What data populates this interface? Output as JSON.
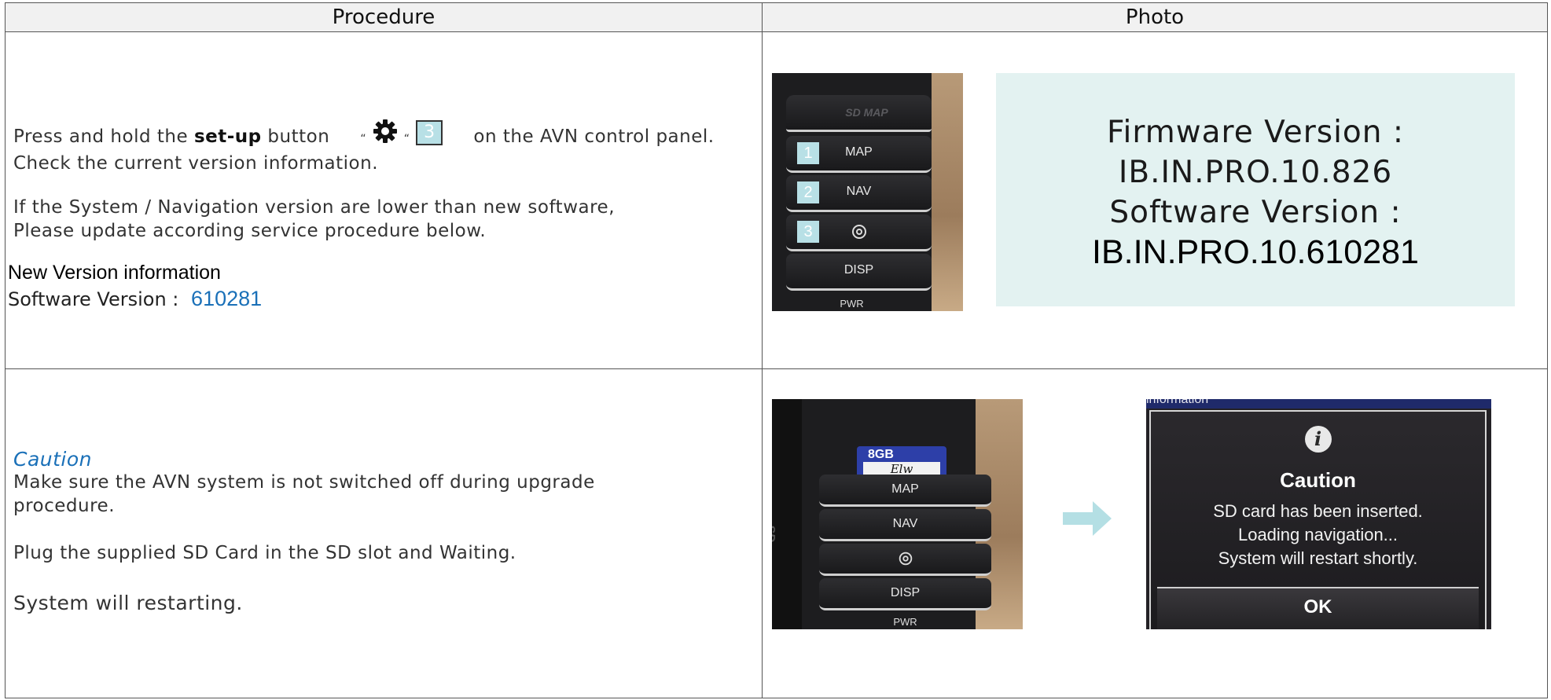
{
  "table": {
    "headers": [
      "Procedure",
      "Photo"
    ]
  },
  "step1": {
    "line1_a": "Press and hold the",
    "line1_bold": "set-up",
    "line1_b": "button",
    "quote_open": "“",
    "quote_close": "“",
    "tag_number": "3",
    "line1_c": "on the AVN control panel.",
    "line2": "Check the current version information.",
    "line3": "If the System / Navigation version are lower than new software,",
    "line4": "Please update according service procedure below.",
    "new_version_title": "New Version information",
    "software_label": "Software Version :",
    "software_value": "610281"
  },
  "panel_photo": {
    "sd_label": "SD MAP",
    "buttons": [
      {
        "tag": "1",
        "label": "MAP"
      },
      {
        "tag": "2",
        "label": "NAV"
      },
      {
        "tag": "3",
        "label": "",
        "icon": "gear-icon"
      }
    ],
    "disp_label": "DISP",
    "pwr_label": "PWR"
  },
  "version_box": {
    "firmware_label": "Firmware Version :",
    "firmware_value": "IB.IN.PRO.10.826",
    "software_label": "Software Version :",
    "software_value": "IB.IN.PRO.10.610281"
  },
  "step2": {
    "caution": "Caution",
    "line1": "Make sure the AVN system is not switched off during upgrade",
    "line2": "procedure.",
    "line3": "Plug the supplied SD Card in the SD slot and Waiting.",
    "line4": "System will restarting."
  },
  "sd_photo": {
    "card_size": "8GB",
    "card_note": "Elw",
    "buttons": [
      "MAP",
      "NAV",
      "",
      "DISP"
    ],
    "pwr_label": "PWR"
  },
  "caution_screen": {
    "top_text": "information",
    "title": "Caution",
    "messages": [
      "SD card has been inserted.",
      "Loading navigation...",
      "System will restart shortly."
    ],
    "ok_label": "OK"
  },
  "colors": {
    "accent_blue": "#1a70b8",
    "tag_cyan": "#b8e0e6",
    "version_box_bg": "#e3f2f1",
    "arrow": "#b4dfe4"
  }
}
